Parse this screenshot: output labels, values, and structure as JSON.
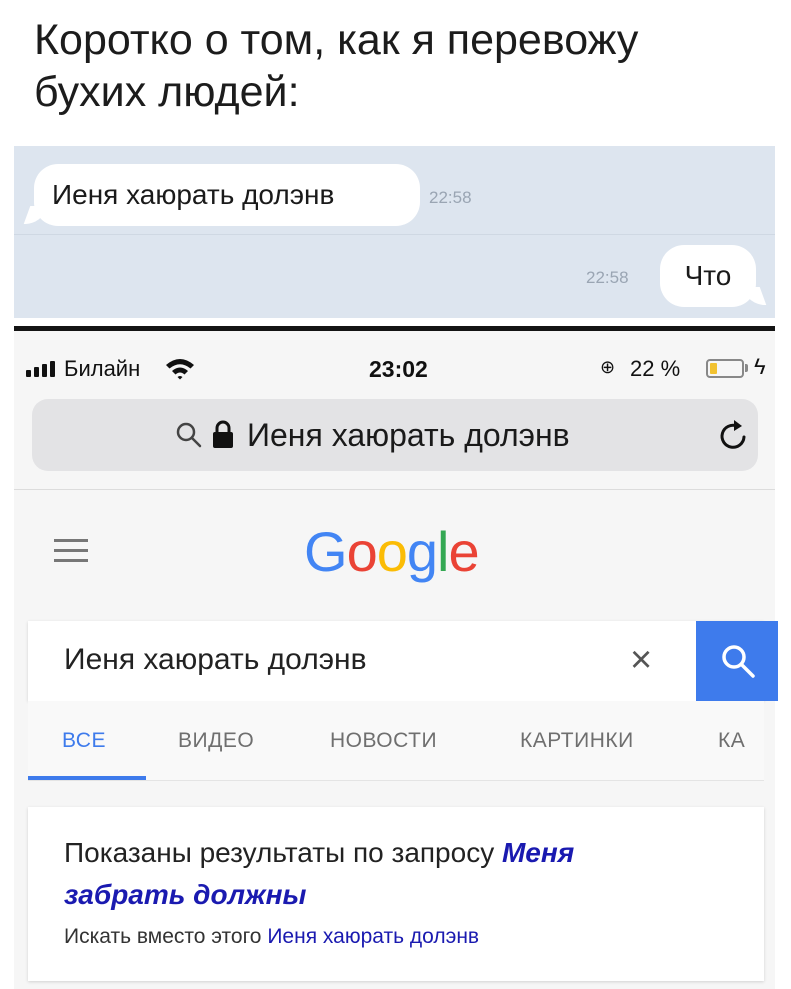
{
  "caption": {
    "line1": "Коротко о том, как я перевожу",
    "line2": "бухих людей:"
  },
  "chat": {
    "incoming": {
      "text": "Иеня хаюрать долэнв",
      "time": "22:58"
    },
    "outgoing": {
      "text": "Что",
      "time": "22:58"
    },
    "background_color": "#dde5ef"
  },
  "statusbar": {
    "carrier": "Билайн",
    "time": "23:02",
    "battery_percent": "22 %",
    "battery_level": 0.22,
    "battery_color": "#f2c230"
  },
  "browser": {
    "url_text": "Иеня хаюрать долэнв",
    "icons": [
      "search-icon",
      "lock-icon",
      "reload-icon"
    ]
  },
  "google": {
    "logo": {
      "letters": [
        "G",
        "o",
        "o",
        "g",
        "l",
        "e"
      ],
      "colors": [
        "#4285f4",
        "#ea4335",
        "#fbbc05",
        "#4285f4",
        "#34a853",
        "#ea4335"
      ]
    },
    "search_value": "Иеня хаюрать долэнв",
    "tabs": [
      "ВСЕ",
      "ВИДЕО",
      "НОВОСТИ",
      "КАРТИНКИ",
      "КА"
    ],
    "active_tab": "ВСЕ",
    "accent_color": "#3e7bec"
  },
  "result": {
    "prefix": "Показаны результаты по запросу ",
    "corrected_part1": "Меня",
    "corrected_part2": "забрать должны",
    "instead_prefix": "Искать вместо этого ",
    "instead_query": "Иеня хаюрать долэнв"
  }
}
